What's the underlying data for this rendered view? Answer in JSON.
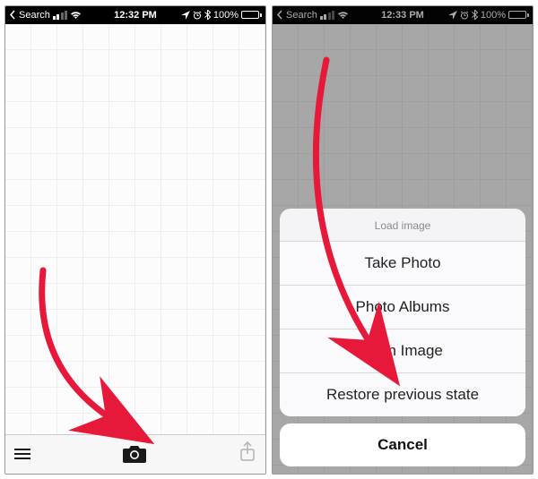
{
  "status_bar": {
    "back_label": "Search",
    "battery_text": "100%"
  },
  "left_screen": {
    "time": "12:32 PM"
  },
  "right_screen": {
    "time": "12:33 PM"
  },
  "action_sheet": {
    "title": "Load image",
    "items": [
      "Take Photo",
      "Photo Albums",
      "Plain Image",
      "Restore previous state"
    ],
    "cancel": "Cancel"
  },
  "arrows": {
    "left_target": "camera-button",
    "right_target": "plain-image-option"
  }
}
